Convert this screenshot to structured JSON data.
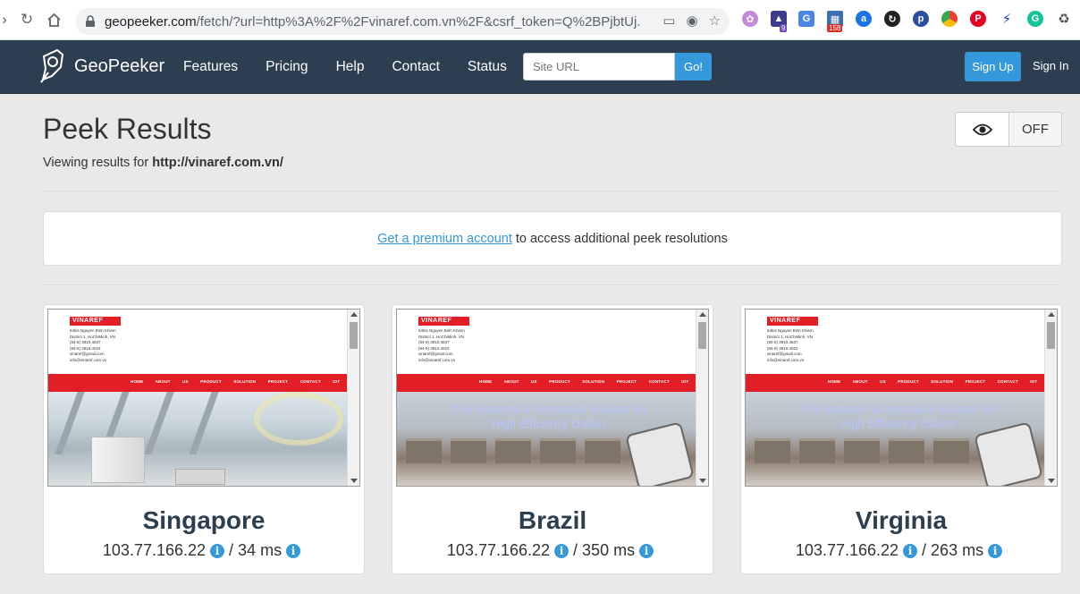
{
  "browser": {
    "url_host": "geopeeker.com",
    "url_path": "/fetch/?url=http%3A%2F%2Fvinaref.com.vn%2F&csrf_token=Q%2BPjbtUj...",
    "extension_badges": [
      "9",
      "158"
    ]
  },
  "nav": {
    "brand": "GeoPeeker",
    "links": [
      "Features",
      "Pricing",
      "Help",
      "Contact",
      "Status"
    ],
    "site_url_placeholder": "Site URL",
    "go_label": "Go!",
    "signup_label": "Sign Up",
    "signin_label": "Sign In"
  },
  "header": {
    "title": "Peek Results",
    "viewing_prefix": "Viewing results for ",
    "viewing_url": "http://vinaref.com.vn/",
    "toggle_state": "OFF"
  },
  "premium": {
    "link_text": "Get a premium account",
    "rest_text": "to access additional peek resolutions"
  },
  "preview": {
    "brand": "VINAREF",
    "address_lines": [
      "54bis Nguyen Binh Khiem",
      "District 1, HoChiMinh, VN",
      "(84-8) 3910.4637",
      "(84-8) 3910.4022",
      "vinaref@gmail.com",
      "info@vinaref.com.vn"
    ],
    "menu": [
      "HOME",
      "ABOUT US",
      "PRODUCT",
      "SOLUTION",
      "PROJECT",
      "CONTACT",
      "IOT"
    ],
    "tagline_1": "The smartest & innovative solution for",
    "tagline_2": "High Efficiency chillers"
  },
  "results": [
    {
      "location": "Singapore",
      "ip": "103.77.166.22",
      "latency": "34 ms"
    },
    {
      "location": "Brazil",
      "ip": "103.77.166.22",
      "latency": "350 ms"
    },
    {
      "location": "Virginia",
      "ip": "103.77.166.22",
      "latency": "263 ms"
    }
  ],
  "colors": {
    "nav_bg": "#2c3e50",
    "accent": "#3498db",
    "brand_red": "#e21e26"
  }
}
